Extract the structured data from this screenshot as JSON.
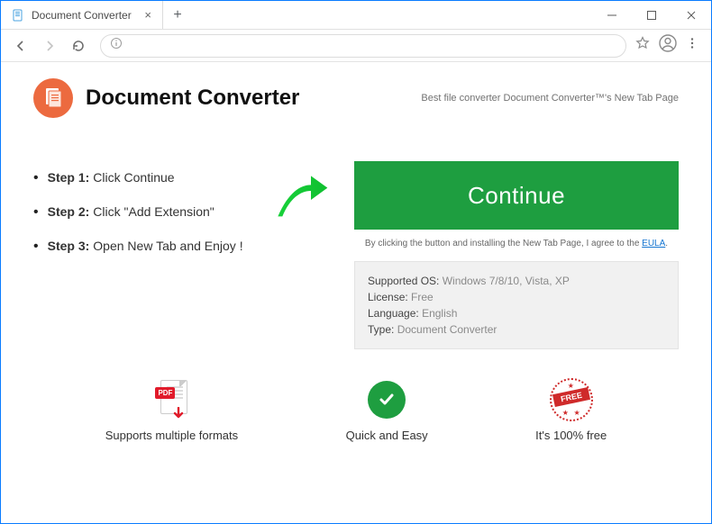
{
  "window": {
    "tab_title": "Document Converter"
  },
  "header": {
    "brand": "Document Converter",
    "tagline": "Best file converter Document Converter™'s New Tab Page"
  },
  "steps": [
    {
      "label": "Step 1:",
      "text": "Click Continue"
    },
    {
      "label": "Step 2:",
      "text": "Click \"Add Extension\""
    },
    {
      "label": "Step 3:",
      "text": "Open New Tab and Enjoy !"
    }
  ],
  "cta": {
    "button": "Continue",
    "disclaimer_pre": "By clicking the button and installing the New Tab Page, I agree to the ",
    "disclaimer_link": "EULA",
    "disclaimer_post": "."
  },
  "info": {
    "os_label": "Supported OS: ",
    "os_value": "Windows 7/8/10, Vista, XP",
    "license_label": "License: ",
    "license_value": "Free",
    "language_label": "Language: ",
    "language_value": "English",
    "type_label": "Type: ",
    "type_value": "Document Converter"
  },
  "features": {
    "f1": "Supports multiple formats",
    "f2": "Quick and Easy",
    "f3": "It's 100% free"
  },
  "icons": {
    "pdf_badge": "PDF",
    "free_stamp": "FREE"
  }
}
